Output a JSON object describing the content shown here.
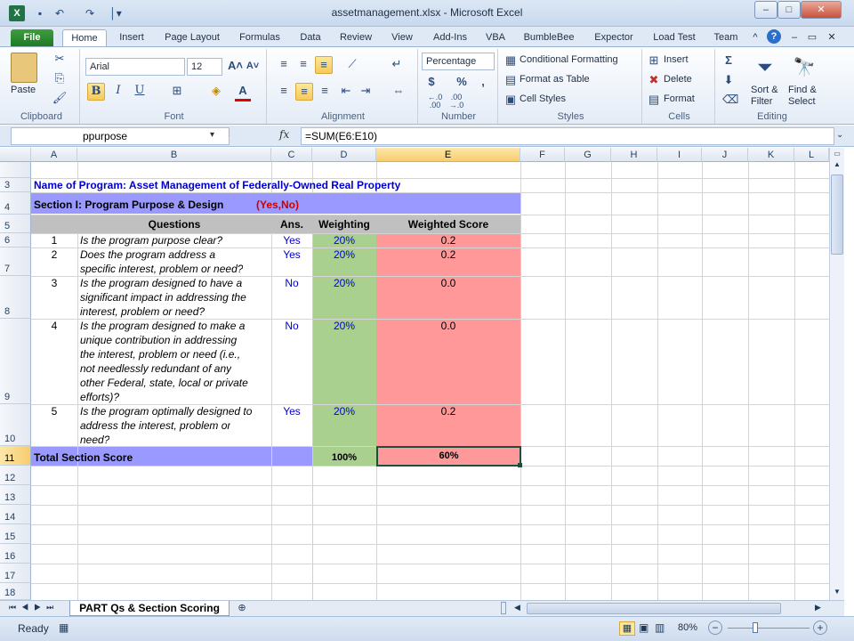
{
  "window": {
    "title": "assetmanagement.xlsx - Microsoft Excel",
    "minimize": "–",
    "maximize": "□",
    "close": "✕"
  },
  "quick_access": {
    "save": "💾",
    "undo": "↶",
    "redo": "↷",
    "customize": "│▾"
  },
  "tabs": [
    "File",
    "Home",
    "Insert",
    "Page Layout",
    "Formulas",
    "Data",
    "Review",
    "View",
    "Add-Ins",
    "VBA",
    "BumbleBee",
    "Expector",
    "Load Test",
    "Team"
  ],
  "ribbon": {
    "clipboard": {
      "label": "Clipboard",
      "paste": "Paste"
    },
    "font": {
      "label": "Font",
      "name": "Arial",
      "size": "12",
      "bold": "B",
      "italic": "I",
      "underline": "U",
      "grow": "A˄",
      "shrink": "A˅",
      "font_color": "A"
    },
    "alignment": {
      "label": "Alignment"
    },
    "number": {
      "label": "Number",
      "format": "Percentage",
      "currency": "$",
      "percent": "%",
      "comma": ",",
      "inc": "←.0\n.00",
      "dec": ".00\n→.0"
    },
    "styles": {
      "label": "Styles",
      "conditional": "Conditional Formatting",
      "table": "Format as Table",
      "cell_styles": "Cell Styles"
    },
    "cells": {
      "label": "Cells",
      "insert": "Insert",
      "delete": "Delete",
      "format": "Format"
    },
    "editing": {
      "label": "Editing",
      "sum": "Σ",
      "sort": "Sort &",
      "filter": "Filter",
      "find": "Find &",
      "select": "Select"
    }
  },
  "formula_bar": {
    "name_box": "ppurpose",
    "fx": "fx",
    "formula": "=SUM(E6:E10)"
  },
  "columns": [
    "A",
    "B",
    "C",
    "D",
    "E",
    "F",
    "G",
    "H",
    "I",
    "J",
    "K",
    "L"
  ],
  "rows": {
    "r3": {
      "num": "3",
      "text": "Name of Program:  Asset Management of Federally-Owned Real Property"
    },
    "r4": {
      "num": "4",
      "text": "Section I:  Program Purpose & Design",
      "ans_hint": "(Yes,No)"
    },
    "r5": {
      "num": "5",
      "questions": "Questions",
      "ans": "Ans.",
      "weighting": "Weighting",
      "weighted": "Weighted Score"
    },
    "items": [
      {
        "num": "6",
        "idx": "1",
        "lines": [
          "Is the program purpose clear?"
        ],
        "ans": "Yes",
        "weight": "20%",
        "score": "0.2"
      },
      {
        "num": "7",
        "idx": "2",
        "lines": [
          "Does the program address a",
          "specific interest, problem or need?"
        ],
        "ans": "Yes",
        "weight": "20%",
        "score": "0.2"
      },
      {
        "num": "8",
        "idx": "3",
        "lines": [
          "Is the program designed to have a",
          "significant impact in addressing the",
          "interest, problem or need?"
        ],
        "ans": "No",
        "weight": "20%",
        "score": "0.0"
      },
      {
        "num": "9",
        "idx": "4",
        "lines": [
          "Is the program designed to make a",
          "unique contribution in addressing",
          "the interest, problem or need (i.e.,",
          "not needlessly redundant of any",
          "other Federal, state, local or private",
          "efforts)?"
        ],
        "ans": "No",
        "weight": "20%",
        "score": "0.0"
      },
      {
        "num": "10",
        "idx": "5",
        "lines": [
          "Is the program optimally designed to",
          "address the interest, problem or",
          "need?"
        ],
        "ans": "Yes",
        "weight": "20%",
        "score": "0.2"
      }
    ],
    "r11": {
      "num": "11",
      "label": "Total Section Score",
      "weight_total": "100%",
      "score_total": "60%"
    },
    "empty": [
      "12",
      "13",
      "14",
      "15",
      "16",
      "17",
      "18"
    ]
  },
  "sheet_tab": {
    "name": "PART Qs & Section Scoring"
  },
  "status": {
    "ready": "Ready",
    "zoom": "80%",
    "minus": "−",
    "plus": "+"
  },
  "colors": {
    "purple_band": "#9999ff",
    "green_col": "#a9d08e",
    "pink_col": "#ff9999",
    "header_gray": "#c0c0c0",
    "blue_text": "#0000cc",
    "red_text": "#cc0000"
  }
}
